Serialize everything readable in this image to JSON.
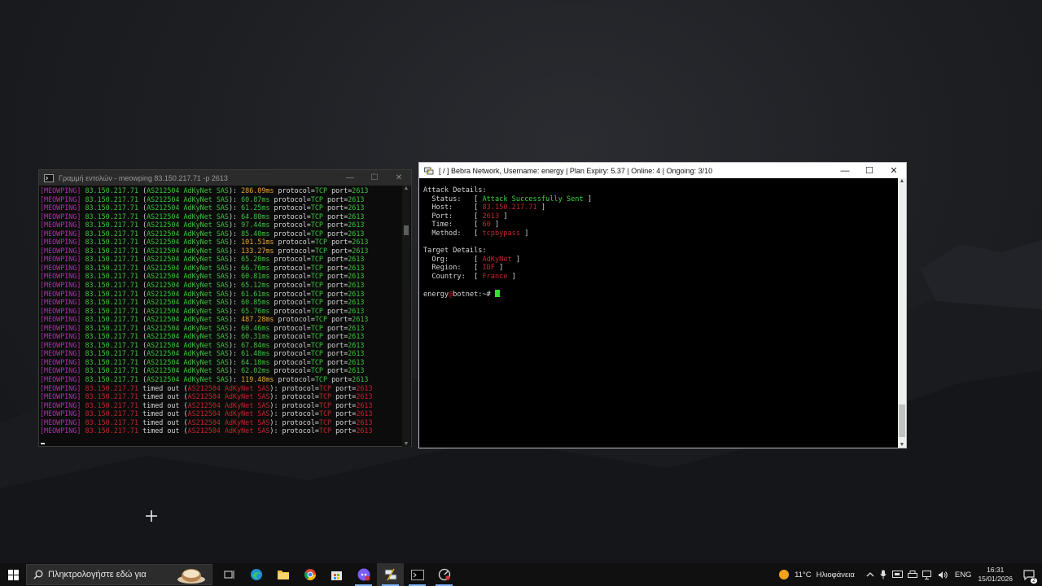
{
  "cmd_window": {
    "title": "Γραμμή εντολών - meowping  83.150.217.71 -p 2613",
    "minimize": "—",
    "maximize": "☐",
    "close": "✕",
    "ok_lines": [
      {
        "tag": "[MEOWPING]",
        "ip": "83.150.217.71",
        "asn": "AS212504 AdKyNet SAS",
        "ms": "286.09ms",
        "slow": true
      },
      {
        "tag": "[MEOWPING]",
        "ip": "83.150.217.71",
        "asn": "AS212504 AdKyNet SAS",
        "ms": "60.87ms",
        "slow": false
      },
      {
        "tag": "[MEOWPING]",
        "ip": "83.150.217.71",
        "asn": "AS212504 AdKyNet SAS",
        "ms": "61.25ms",
        "slow": false
      },
      {
        "tag": "[MEOWPING]",
        "ip": "83.150.217.71",
        "asn": "AS212504 AdKyNet SAS",
        "ms": "64.80ms",
        "slow": false
      },
      {
        "tag": "[MEOWPING]",
        "ip": "83.150.217.71",
        "asn": "AS212504 AdKyNet SAS",
        "ms": "97.44ms",
        "slow": false
      },
      {
        "tag": "[MEOWPING]",
        "ip": "83.150.217.71",
        "asn": "AS212504 AdKyNet SAS",
        "ms": "85.40ms",
        "slow": false
      },
      {
        "tag": "[MEOWPING]",
        "ip": "83.150.217.71",
        "asn": "AS212504 AdKyNet SAS",
        "ms": "101.51ms",
        "slow": true
      },
      {
        "tag": "[MEOWPING]",
        "ip": "83.150.217.71",
        "asn": "AS212504 AdKyNet SAS",
        "ms": "133.27ms",
        "slow": true
      },
      {
        "tag": "[MEOWPING]",
        "ip": "83.150.217.71",
        "asn": "AS212504 AdKyNet SAS",
        "ms": "65.20ms",
        "slow": false
      },
      {
        "tag": "[MEOWPING]",
        "ip": "83.150.217.71",
        "asn": "AS212504 AdKyNet SAS",
        "ms": "66.76ms",
        "slow": false
      },
      {
        "tag": "[MEOWPING]",
        "ip": "83.150.217.71",
        "asn": "AS212504 AdKyNet SAS",
        "ms": "60.81ms",
        "slow": false
      },
      {
        "tag": "[MEOWPING]",
        "ip": "83.150.217.71",
        "asn": "AS212504 AdKyNet SAS",
        "ms": "65.12ms",
        "slow": false
      },
      {
        "tag": "[MEOWPING]",
        "ip": "83.150.217.71",
        "asn": "AS212504 AdKyNet SAS",
        "ms": "61.61ms",
        "slow": false
      },
      {
        "tag": "[MEOWPING]",
        "ip": "83.150.217.71",
        "asn": "AS212504 AdKyNet SAS",
        "ms": "60.85ms",
        "slow": false
      },
      {
        "tag": "[MEOWPING]",
        "ip": "83.150.217.71",
        "asn": "AS212504 AdKyNet SAS",
        "ms": "65.76ms",
        "slow": false
      },
      {
        "tag": "[MEOWPING]",
        "ip": "83.150.217.71",
        "asn": "AS212504 AdKyNet SAS",
        "ms": "487.28ms",
        "slow": true
      },
      {
        "tag": "[MEOWPING]",
        "ip": "83.150.217.71",
        "asn": "AS212504 AdKyNet SAS",
        "ms": "60.46ms",
        "slow": false
      },
      {
        "tag": "[MEOWPING]",
        "ip": "83.150.217.71",
        "asn": "AS212504 AdKyNet SAS",
        "ms": "60.31ms",
        "slow": false
      },
      {
        "tag": "[MEOWPING]",
        "ip": "83.150.217.71",
        "asn": "AS212504 AdKyNet SAS",
        "ms": "67.84ms",
        "slow": false
      },
      {
        "tag": "[MEOWPING]",
        "ip": "83.150.217.71",
        "asn": "AS212504 AdKyNet SAS",
        "ms": "61.48ms",
        "slow": false
      },
      {
        "tag": "[MEOWPING]",
        "ip": "83.150.217.71",
        "asn": "AS212504 AdKyNet SAS",
        "ms": "64.18ms",
        "slow": false
      },
      {
        "tag": "[MEOWPING]",
        "ip": "83.150.217.71",
        "asn": "AS212504 AdKyNet SAS",
        "ms": "62.02ms",
        "slow": false
      },
      {
        "tag": "[MEOWPING]",
        "ip": "83.150.217.71",
        "asn": "AS212504 AdKyNet SAS",
        "ms": "119.48ms",
        "slow": true
      }
    ],
    "timeout_lines": [
      {
        "tag": "[MEOWPING]",
        "ip": "83.150.217.71",
        "asn": "AS212504 AdKyNet SAS"
      },
      {
        "tag": "[MEOWPING]",
        "ip": "83.150.217.71",
        "asn": "AS212504 AdKyNet SAS"
      },
      {
        "tag": "[MEOWPING]",
        "ip": "83.150.217.71",
        "asn": "AS212504 AdKyNet SAS"
      },
      {
        "tag": "[MEOWPING]",
        "ip": "83.150.217.71",
        "asn": "AS212504 AdKyNet SAS"
      },
      {
        "tag": "[MEOWPING]",
        "ip": "83.150.217.71",
        "asn": "AS212504 AdKyNet SAS"
      },
      {
        "tag": "[MEOWPING]",
        "ip": "83.150.217.71",
        "asn": "AS212504 AdKyNet SAS"
      }
    ],
    "words": {
      "protocol_key": "protocol=",
      "protocol_val": "TCP",
      "port_key": "port=",
      "port_val": "2613",
      "timed_out": "timed out"
    }
  },
  "putty_window": {
    "title": "[ / ] Bebra Network, Username: energy | Plan Expiry: 5.37 | Online: 4 | Ongoing: 3/10",
    "minimize": "—",
    "maximize": "☐",
    "close": "✕",
    "attack_header": "Attack Details:",
    "attack_rows": [
      {
        "label": "  Status:   ",
        "value": "Attack Successfully Sent",
        "color": "green"
      },
      {
        "label": "  Host:     ",
        "value": "83.150.217.71",
        "color": "red"
      },
      {
        "label": "  Port:     ",
        "value": "2613",
        "color": "red"
      },
      {
        "label": "  Time:     ",
        "value": "60",
        "color": "red"
      },
      {
        "label": "  Method:   ",
        "value": "tcpbypass",
        "color": "red"
      }
    ],
    "target_header": "Target Details:",
    "target_rows": [
      {
        "label": "  Org:      ",
        "value": "AdKyNet",
        "color": "red"
      },
      {
        "label": "  Region:   ",
        "value": "IDF",
        "color": "red"
      },
      {
        "label": "  Country:  ",
        "value": "France",
        "color": "red"
      }
    ],
    "prompt_user": "energy",
    "prompt_at": "@",
    "prompt_host": "botnet:~# "
  },
  "taskbar": {
    "search_placeholder": "Πληκτρολογήστε εδώ για",
    "weather_temp": "11°C",
    "weather_text": "Ηλιοφάνεια",
    "language": "ENG",
    "time": "16:31",
    "date": "15/01/2026",
    "notification_count": "2"
  }
}
